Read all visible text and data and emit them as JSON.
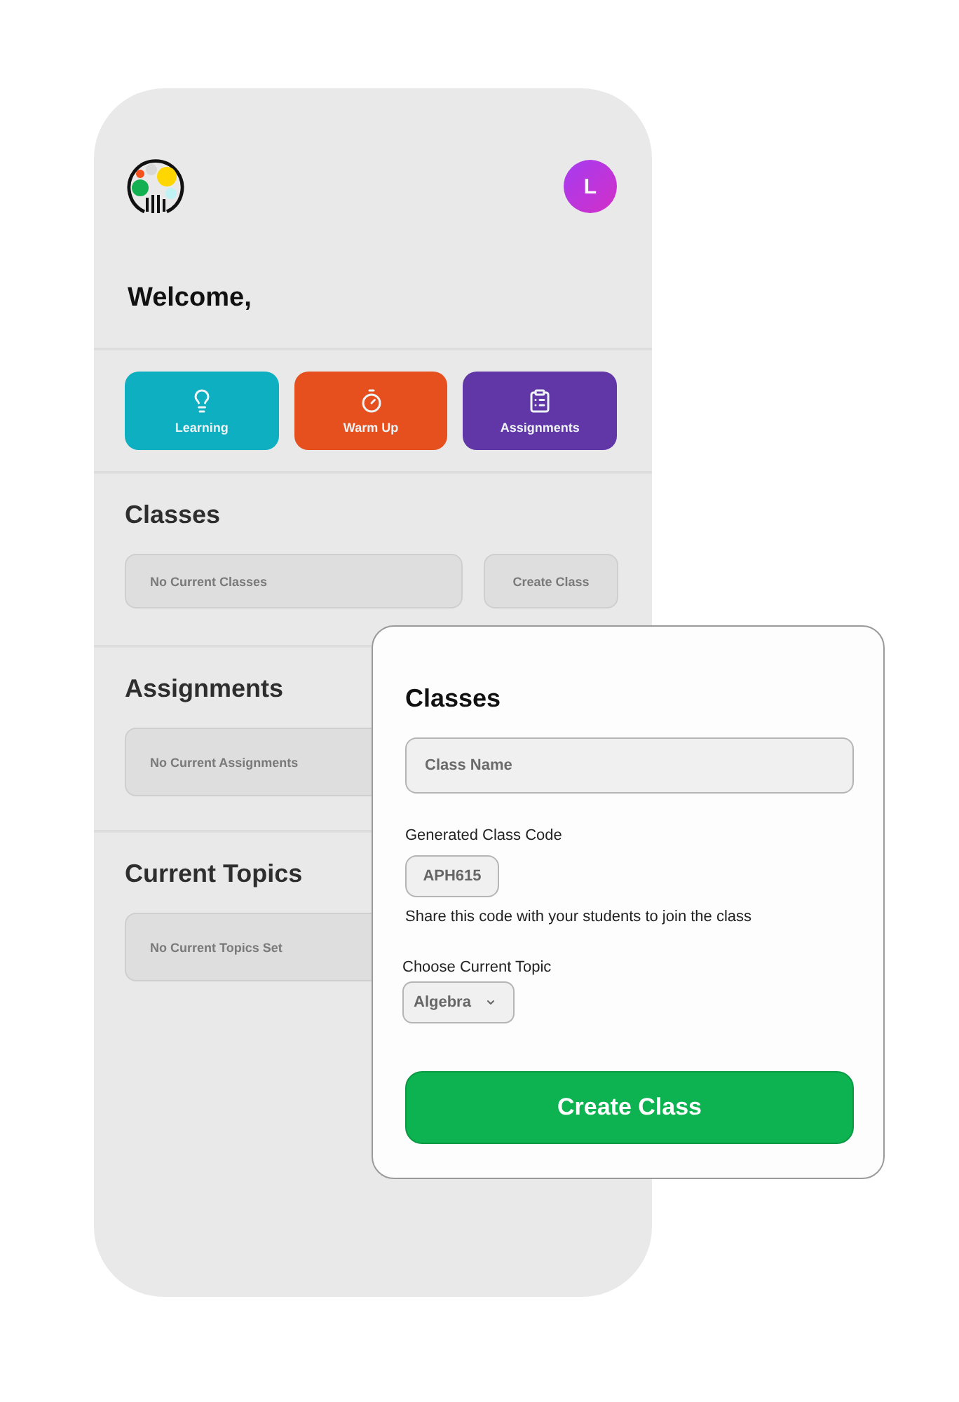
{
  "header": {
    "avatar_initial": "L"
  },
  "greeting": "Welcome,",
  "tiles": [
    {
      "kind": "learning",
      "label": "Learning",
      "color": "#0eafc1"
    },
    {
      "kind": "warmup",
      "label": "Warm Up",
      "color": "#e5501e"
    },
    {
      "kind": "assignments",
      "label": "Assignments",
      "color": "#6137a8"
    }
  ],
  "sections": [
    {
      "title": "Classes",
      "empty_text": "No Current Classes",
      "button": "Create Class"
    },
    {
      "title": "Assignments",
      "empty_text": "No Current Assignments"
    },
    {
      "title": "Current Topics",
      "empty_text": "No Current Topics Set"
    }
  ],
  "dialog": {
    "title": "Classes",
    "class_name": {
      "placeholder": "Class Name"
    },
    "code_label": "Generated Class Code",
    "code": "APH615",
    "code_hint": "Share this code with your students to join the class",
    "topic_label": "Choose Current Topic",
    "topic": {
      "value": "Algebra"
    },
    "submit": "Create Class"
  }
}
